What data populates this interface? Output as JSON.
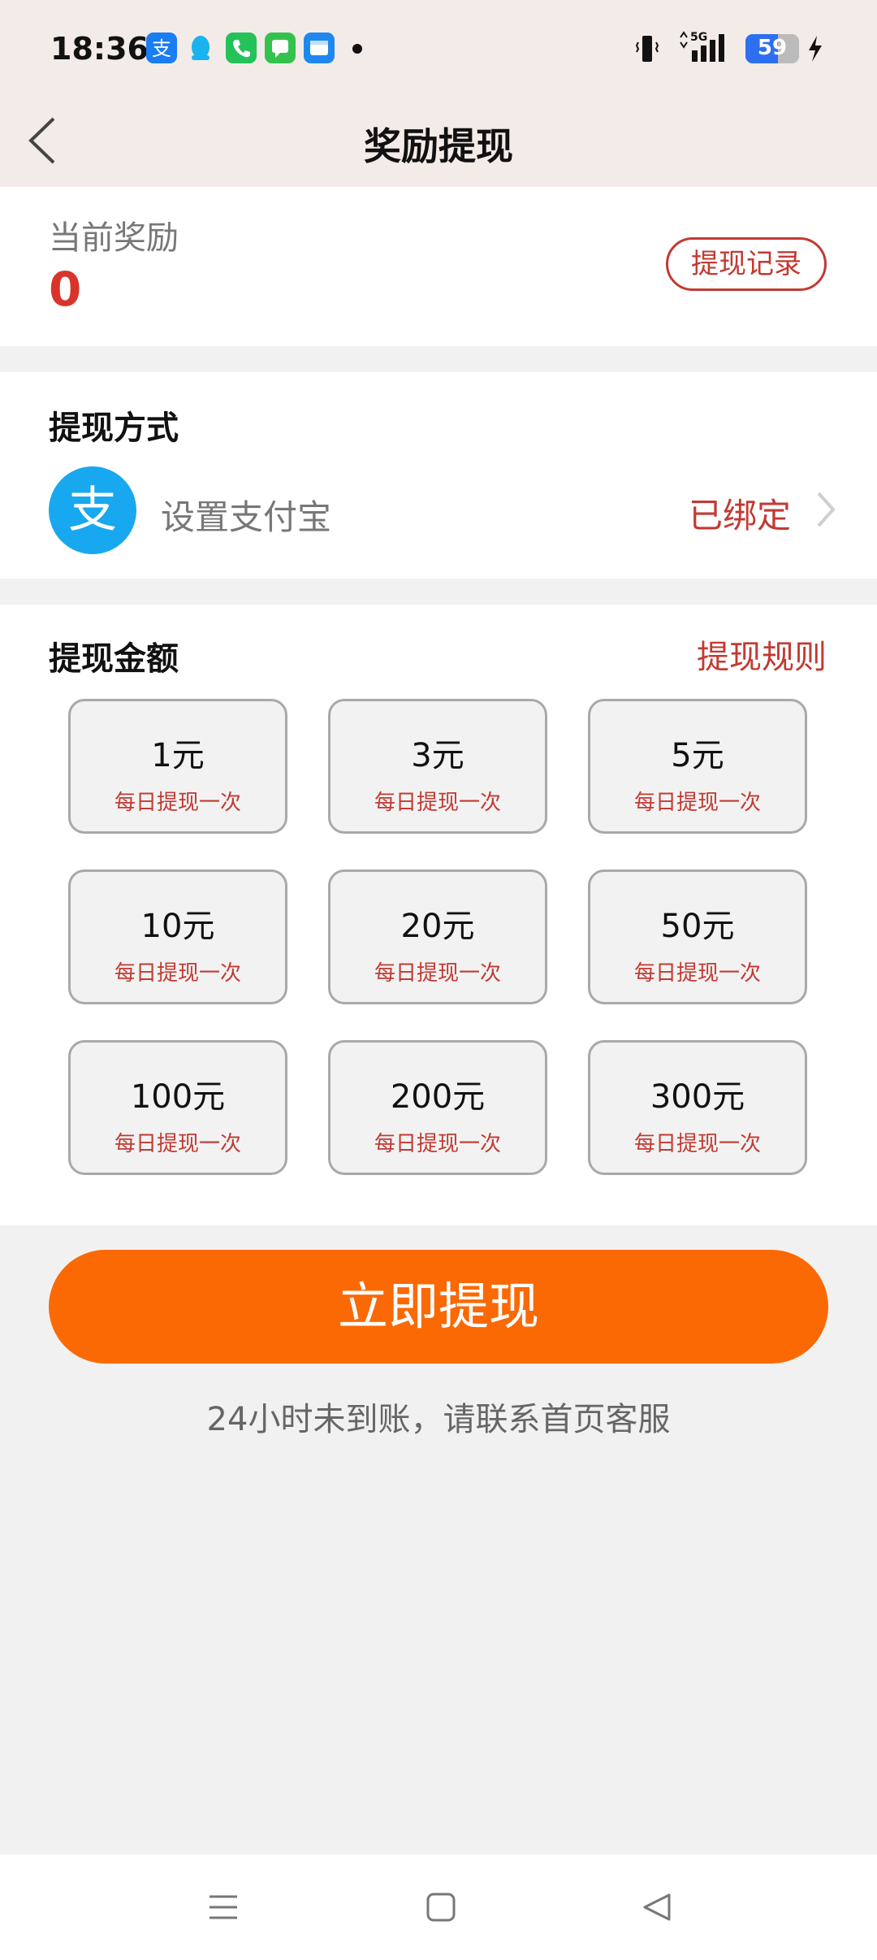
{
  "status_bar": {
    "time": "18:36",
    "battery": "59",
    "network": "5G",
    "notification_icons": [
      "alipay-icon",
      "qq-icon",
      "phone-icon",
      "messages-icon",
      "calendar-icon"
    ]
  },
  "nav": {
    "title": "奖励提现",
    "back_icon": "chevron-left-icon"
  },
  "balance": {
    "label": "当前奖励",
    "value": "0",
    "record_button": "提现记录"
  },
  "method": {
    "title": "提现方式",
    "icon": "alipay-icon",
    "label": "设置支付宝",
    "status": "已绑定",
    "status_icon": "chevron-right-icon"
  },
  "amounts": {
    "title": "提现金额",
    "rules_link": "提现规则",
    "options": [
      {
        "amount": "1元",
        "note": "每日提现一次"
      },
      {
        "amount": "3元",
        "note": "每日提现一次"
      },
      {
        "amount": "5元",
        "note": "每日提现一次"
      },
      {
        "amount": "10元",
        "note": "每日提现一次"
      },
      {
        "amount": "20元",
        "note": "每日提现一次"
      },
      {
        "amount": "50元",
        "note": "每日提现一次"
      },
      {
        "amount": "100元",
        "note": "每日提现一次"
      },
      {
        "amount": "200元",
        "note": "每日提现一次"
      },
      {
        "amount": "300元",
        "note": "每日提现一次"
      }
    ]
  },
  "action": {
    "button": "立即提现",
    "hint": "24小时未到账，请联系首页客服"
  },
  "colors": {
    "accent": "#fb6904",
    "red": "#c23a32",
    "header_bg": "#f3ebe8"
  },
  "system_nav": [
    "menu-icon",
    "home-icon",
    "back-triangle-icon"
  ]
}
